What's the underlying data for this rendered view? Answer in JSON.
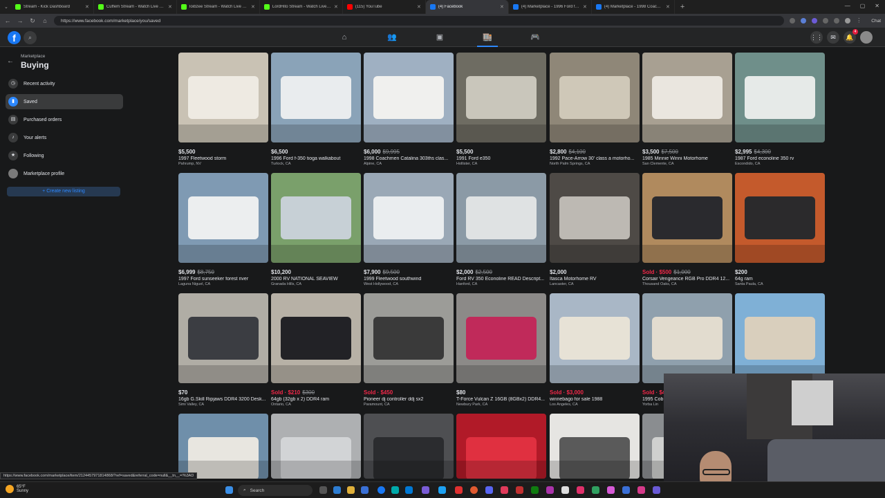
{
  "browser": {
    "tabs": [
      {
        "label": "Stream - Kick Dashboard",
        "color": "#53fc18"
      },
      {
        "label": "Cuffem Stream - Watch Live on Ki",
        "color": "#53fc18"
      },
      {
        "label": "Ioibzee Stream - Watch Live on Ki",
        "color": "#53fc18"
      },
      {
        "label": "LordHito Stream - Watch Live on K",
        "color": "#53fc18"
      },
      {
        "label": "(115) YouTube",
        "color": "#ff0000"
      },
      {
        "label": "(4) Facebook",
        "color": "#1877f2"
      },
      {
        "label": "(4) Marketplace - 1996 Ford f-350",
        "color": "#1877f2"
      },
      {
        "label": "(4) Marketplace - 1998 Coachmen",
        "color": "#1877f2"
      }
    ],
    "url": "https://www.facebook.com/marketplace/you/saved",
    "status_url": "https://www.facebook.com/marketplace/item/2124457971814868/?ref=saved&referral_code=null&__tn__=!%3AD"
  },
  "fb_nav": {
    "logo": "f",
    "icons": [
      "home-icon",
      "friends-icon",
      "watch-icon",
      "marketplace-icon",
      "gaming-icon"
    ],
    "notifications_count": "4"
  },
  "sidebar": {
    "supertitle": "Marketplace",
    "title": "Buying",
    "items": [
      {
        "label": "Recent activity",
        "icon": "clock-icon"
      },
      {
        "label": "Saved",
        "icon": "bookmark-icon"
      },
      {
        "label": "Purchased orders",
        "icon": "receipt-icon"
      },
      {
        "label": "Your alerts",
        "icon": "bell-icon"
      },
      {
        "label": "Following",
        "icon": "following-icon"
      },
      {
        "label": "Marketplace profile",
        "icon": "avatar-icon"
      }
    ],
    "create_label": "+ Create new listing"
  },
  "listings": [
    {
      "price": "$5,500",
      "orig": "",
      "sold": "",
      "title": "1997 Fleetwood storm",
      "loc": "Pahrump, NV",
      "bg": "#c9c2b4",
      "fg": "#eeeae2"
    },
    {
      "price": "$6,500",
      "orig": "",
      "sold": "",
      "title": "1996 Ford f-350 tioga walkabout",
      "loc": "Turlock, CA",
      "bg": "#8aa3b8",
      "fg": "#e9ecee"
    },
    {
      "price": "$6,000",
      "orig": "$9,995",
      "sold": "",
      "title": "1998 Coachmen Catalina 303ths clas...",
      "loc": "Alpine, CA",
      "bg": "#9fb0c2",
      "fg": "#f0f0ee"
    },
    {
      "price": "$5,500",
      "orig": "",
      "sold": "",
      "title": "1991 Ford e350",
      "loc": "Hollister, CA",
      "bg": "#6e6c62",
      "fg": "#c9c6bb"
    },
    {
      "price": "$2,800",
      "orig": "$4,100",
      "sold": "",
      "title": "1992 Pace-Arrow 30' class a motorho...",
      "loc": "North Palm Springs, CA",
      "bg": "#8f8778",
      "fg": "#cfc8b8"
    },
    {
      "price": "$3,500",
      "orig": "$7,500",
      "sold": "",
      "title": "1985 Minnie Winni Motorhome",
      "loc": "San Clemente, CA",
      "bg": "#a8a092",
      "fg": "#eae6df"
    },
    {
      "price": "$2,995",
      "orig": "$4,300",
      "sold": "",
      "title": "1987 Ford econoline 350 rv",
      "loc": "Escondido, CA",
      "bg": "#6f8f8a",
      "fg": "#e6eae8"
    },
    {
      "price": "$6,999",
      "orig": "$8,750",
      "sold": "",
      "title": "1997 Ford sunseeker forest river",
      "loc": "Laguna Niguel, CA",
      "bg": "#7f9ab3",
      "fg": "#eceeef"
    },
    {
      "price": "$10,200",
      "orig": "",
      "sold": "",
      "title": "2000 RV NATIONAL SEAVIEW",
      "loc": "Granada Hills, CA",
      "bg": "#7aa06b",
      "fg": "#c7d0d6"
    },
    {
      "price": "$7,900",
      "orig": "$9,500",
      "sold": "",
      "title": "1999 Fleetwood southwind",
      "loc": "West Hollywood, CA",
      "bg": "#9aa8b6",
      "fg": "#eaedef"
    },
    {
      "price": "$2,000",
      "orig": "$2,500",
      "sold": "",
      "title": "Ford RV 350 Econoline READ Descript...",
      "loc": "Hanford, CA",
      "bg": "#8b9aa6",
      "fg": "#dfe2e3"
    },
    {
      "price": "$2,000",
      "orig": "",
      "sold": "",
      "title": "Itasca Motorhome RV",
      "loc": "Lancaster, CA",
      "bg": "#4e4a46",
      "fg": "#bdb9b3"
    },
    {
      "price": "$500",
      "orig": "$1,000",
      "sold": "Sold · ",
      "title": "Corsair Vengeance RGB Pro DDR4 12...",
      "loc": "Thousand Oaks, CA",
      "bg": "#b08a5e",
      "fg": "#2a2a2e"
    },
    {
      "price": "$200",
      "orig": "",
      "sold": "",
      "title": "64g ram",
      "loc": "Santa Paula, CA",
      "bg": "#c45a2c",
      "fg": "#2b2a2c"
    },
    {
      "price": "$70",
      "orig": "",
      "sold": "",
      "title": "16gb G.Skill Ripjaws DDR4 3200 Desk...",
      "loc": "Simi Valley, CA",
      "bg": "#b0ada5",
      "fg": "#3b3d42"
    },
    {
      "price": "$210",
      "orig": "$300",
      "sold": "Sold · ",
      "title": "64gb (32gb x 2) DDR4 ram",
      "loc": "Ontario, CA",
      "bg": "#b7b1a6",
      "fg": "#222226"
    },
    {
      "price": "$450",
      "orig": "",
      "sold": "Sold · ",
      "title": "Pioneer dj controller ddj sx2",
      "loc": "Paramount, CA",
      "bg": "#9c9c98",
      "fg": "#3a3a3a"
    },
    {
      "price": "$80",
      "orig": "",
      "sold": "",
      "title": "T-Force Vulcan Z 16GB (8GBx2) DDR4...",
      "loc": "Newbury Park, CA",
      "bg": "#8c8a88",
      "fg": "#c02a5a"
    },
    {
      "price": "$3,000",
      "orig": "",
      "sold": "Sold · ",
      "title": "winnebago for sale 1988",
      "loc": "Los Angeles, CA",
      "bg": "#a9b7c6",
      "fg": "#e7e2d6"
    },
    {
      "price": "$4",
      "orig": "",
      "sold": "Sold · ",
      "title": "1995 Cob",
      "loc": "Yorba Lin",
      "bg": "#8fa0ad",
      "fg": "#e2dccf"
    },
    {
      "price": "",
      "orig": "",
      "sold": "",
      "title": "",
      "loc": "",
      "bg": "#7fb0d6",
      "fg": "#d9cfbd"
    },
    {
      "price": "",
      "orig": "",
      "sold": "",
      "title": "",
      "loc": "",
      "bg": "#6f8faa",
      "fg": "#e8e6e0"
    },
    {
      "price": "",
      "orig": "",
      "sold": "",
      "title": "",
      "loc": "",
      "bg": "#aeb0b2",
      "fg": "#d2d4d6"
    },
    {
      "price": "",
      "orig": "",
      "sold": "",
      "title": "",
      "loc": "",
      "bg": "#4e4f52",
      "fg": "#2b2c2f"
    },
    {
      "price": "",
      "orig": "",
      "sold": "",
      "title": "",
      "loc": "",
      "bg": "#b11a28",
      "fg": "#e03040"
    },
    {
      "price": "",
      "orig": "",
      "sold": "",
      "title": "",
      "loc": "",
      "bg": "#e6e5e2",
      "fg": "#5a5a5a"
    },
    {
      "price": "",
      "orig": "",
      "sold": "",
      "title": "",
      "loc": "",
      "bg": "#8a8d90",
      "fg": "#cfd0cf"
    }
  ],
  "taskbar": {
    "weather_temp": "65°F",
    "weather_desc": "Sunny",
    "search_label": "Search"
  }
}
